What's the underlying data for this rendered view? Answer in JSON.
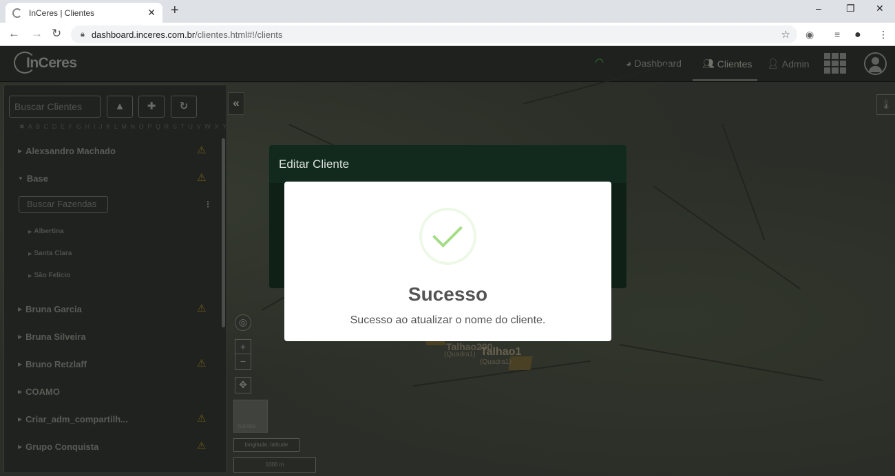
{
  "browser": {
    "tab_title": "InCeres | Clientes",
    "tab_close": "✕",
    "new_tab": "+",
    "url_host": "dashboard.inceres.com.br",
    "url_path": "/clientes.html#!/clients",
    "minimize": "–",
    "restore": "❐",
    "close": "✕"
  },
  "header": {
    "logo_text": "InCeres",
    "nav": [
      {
        "label": "Dashboard",
        "icon": "dashboard-icon"
      },
      {
        "label": "Clientes",
        "icon": "users-icon",
        "active": true
      },
      {
        "label": "Admin",
        "icon": "user-plus-icon"
      }
    ]
  },
  "sidebar": {
    "search_placeholder": "Buscar Clientes",
    "alphabet": "✖ A B C D E F G H I J K L M N O P Q R S T U V W X Y Z",
    "farm_search_placeholder": "Buscar Fazendas",
    "clients": [
      {
        "name": "Alexsandro Machado",
        "warning": true,
        "expanded": false
      },
      {
        "name": "Base",
        "warning": true,
        "expanded": true
      },
      {
        "name": "Bruna Garcia",
        "warning": true,
        "expanded": false
      },
      {
        "name": "Bruna Silveira",
        "warning": false,
        "expanded": false
      },
      {
        "name": "Bruno Retzlaff",
        "warning": true,
        "expanded": false
      },
      {
        "name": "COAMO",
        "warning": false,
        "expanded": false
      },
      {
        "name": "Criar_adm_compartilh...",
        "warning": true,
        "expanded": false
      },
      {
        "name": "Grupo Conquista",
        "warning": true,
        "expanded": false
      }
    ],
    "farms": [
      "Albertina",
      "Santa Clara",
      "São Felício"
    ]
  },
  "map": {
    "plot_label_1": "Talhao1",
    "plot_sub_1": "(Quadra1)",
    "plot_label_2": "Talhao200",
    "plot_sub_2": "(Quadra1)",
    "coord_label": "longitude, latitude",
    "scale_label": "1000 m",
    "thumb_label": "Satélite"
  },
  "edit_modal": {
    "title": "Editar Cliente"
  },
  "success_dialog": {
    "title": "Sucesso",
    "message": "Sucesso ao atualizar o nome do cliente."
  }
}
